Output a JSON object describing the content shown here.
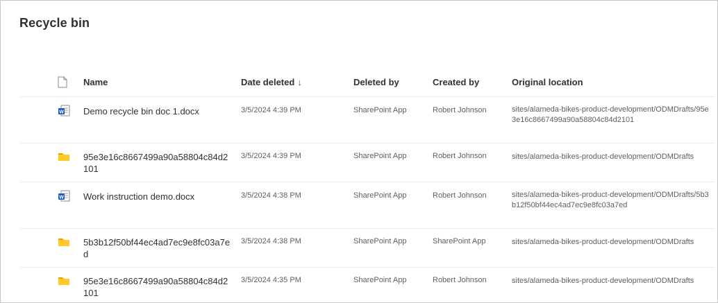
{
  "page": {
    "title": "Recycle bin"
  },
  "columns": {
    "type_icon": "file-type-icon",
    "name": "Name",
    "date_deleted": "Date deleted",
    "sort_indicator": "↓",
    "deleted_by": "Deleted by",
    "created_by": "Created by",
    "original_location": "Original location"
  },
  "rows": [
    {
      "icon": "word-doc-icon",
      "name": "Demo recycle bin doc 1.docx",
      "date_deleted": "3/5/2024 4:39 PM",
      "deleted_by": "SharePoint App",
      "created_by": "Robert Johnson",
      "original_location": "sites/alameda-bikes-product-development/ODMDrafts/95e3e16c8667499a90a58804c84d2101"
    },
    {
      "icon": "folder-icon",
      "name": "95e3e16c8667499a90a58804c84d2101",
      "date_deleted": "3/5/2024 4:39 PM",
      "deleted_by": "SharePoint App",
      "created_by": "Robert Johnson",
      "original_location": "sites/alameda-bikes-product-development/ODMDrafts"
    },
    {
      "icon": "word-doc-icon",
      "name": "Work instruction demo.docx",
      "date_deleted": "3/5/2024 4:38 PM",
      "deleted_by": "SharePoint App",
      "created_by": "Robert Johnson",
      "original_location": "sites/alameda-bikes-product-development/ODMDrafts/5b3b12f50bf44ec4ad7ec9e8fc03a7ed"
    },
    {
      "icon": "folder-icon",
      "name": "5b3b12f50bf44ec4ad7ec9e8fc03a7ed",
      "date_deleted": "3/5/2024 4:38 PM",
      "deleted_by": "SharePoint App",
      "created_by": "SharePoint App",
      "original_location": "sites/alameda-bikes-product-development/ODMDrafts"
    },
    {
      "icon": "folder-icon",
      "name": "95e3e16c8667499a90a58804c84d2101",
      "date_deleted": "3/5/2024 4:35 PM",
      "deleted_by": "SharePoint App",
      "created_by": "Robert Johnson",
      "original_location": "sites/alameda-bikes-product-development/ODMDrafts"
    }
  ],
  "colors": {
    "folder": "#FFCA28",
    "word_blue": "#185ABD",
    "text_primary": "#323130",
    "text_secondary": "#605e5c",
    "divider": "#edebe9"
  }
}
